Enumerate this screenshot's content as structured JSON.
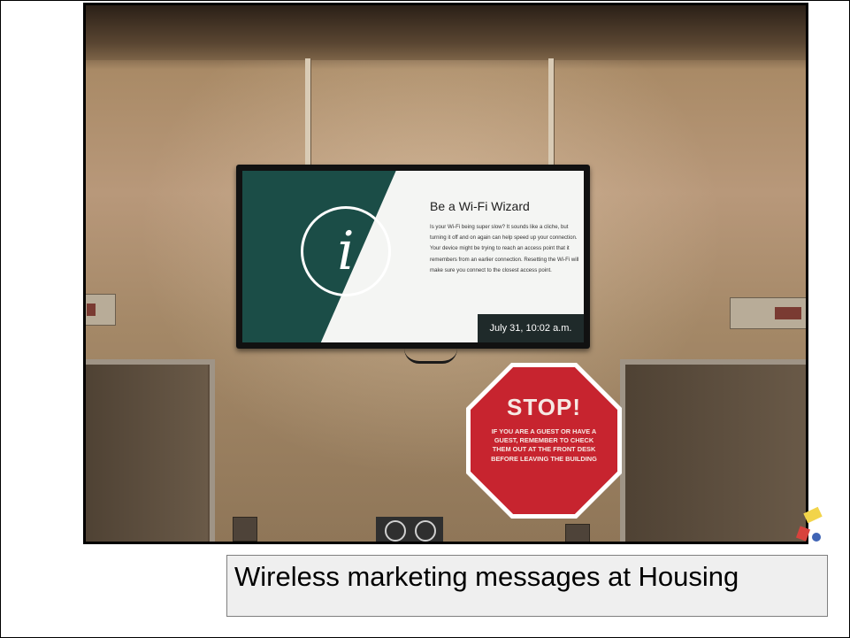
{
  "tv_slide": {
    "title": "Be a Wi-Fi Wizard",
    "body": "Is your Wi-Fi being super slow? It sounds like a cliche, but turning it off and on again can help speed up your connection. Your device might be trying to reach an access point that it remembers from an earlier connection. Resetting the Wi-Fi will make sure you connect to the closest access point.",
    "timestamp": "July 31, 10:02 a.m.",
    "icon": "info-icon"
  },
  "stop_sign": {
    "title": "STOP!",
    "text": "IF YOU ARE A GUEST OR HAVE A GUEST, REMEMBER TO CHECK THEM OUT AT THE FRONT DESK BEFORE LEAVING THE BUILDING"
  },
  "caption": {
    "text": "Wireless marketing messages at Housing"
  },
  "colors": {
    "teal": "#1b4d47",
    "stop_red": "#c7242f"
  }
}
